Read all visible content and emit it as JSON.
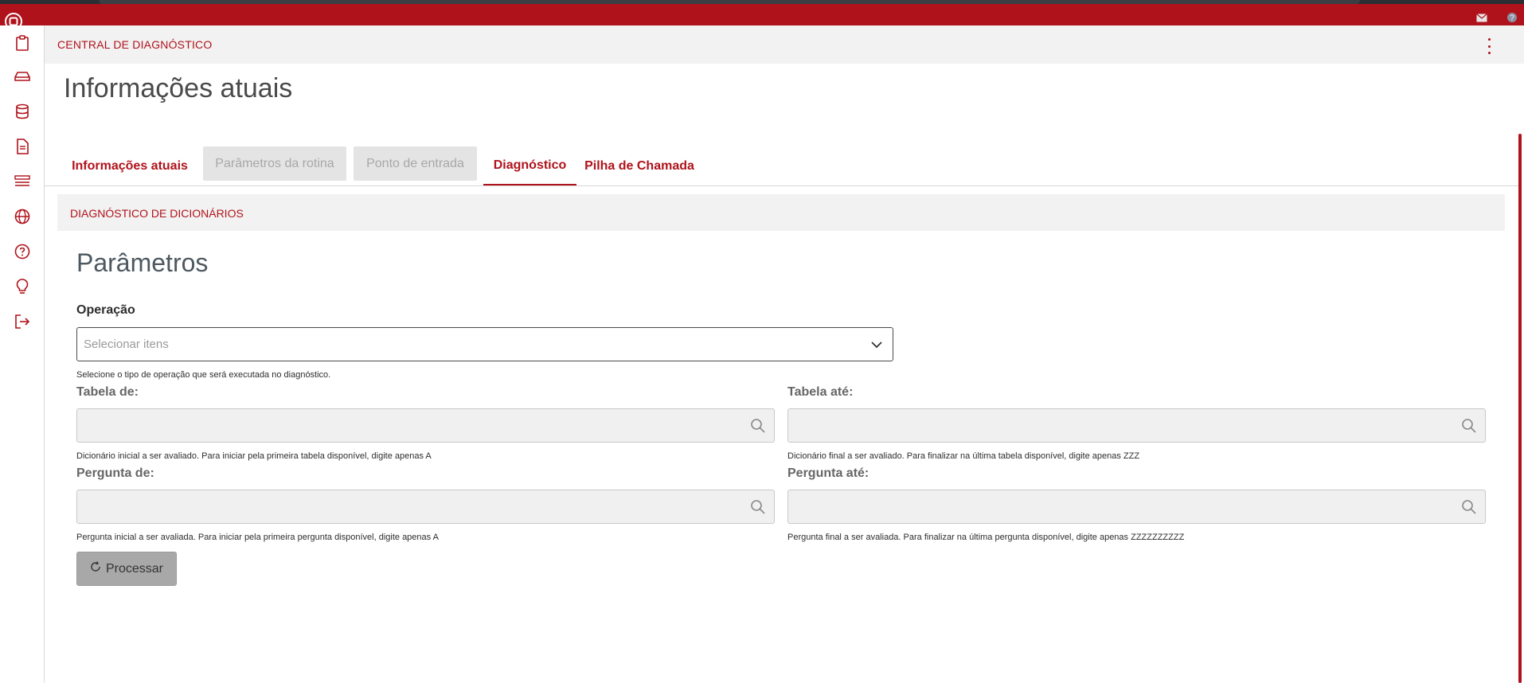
{
  "app": {
    "title": "CENTRAL DE DIAGNÓSTICO",
    "brand_color": "#b0121b"
  },
  "sidebar": {
    "items": [
      {
        "icon": "clipboard-icon"
      },
      {
        "icon": "hard-drive-icon"
      },
      {
        "icon": "database-icon"
      },
      {
        "icon": "document-icon"
      },
      {
        "icon": "list-icon"
      },
      {
        "icon": "globe-icon"
      },
      {
        "icon": "help-circle-icon"
      },
      {
        "icon": "lightbulb-icon"
      },
      {
        "icon": "logout-icon"
      }
    ]
  },
  "page": {
    "title": "Informações atuais"
  },
  "tabs": [
    {
      "label": "Informações atuais",
      "state": "enabled"
    },
    {
      "label": "Parâmetros da rotina",
      "state": "disabled"
    },
    {
      "label": "Ponto de entrada",
      "state": "disabled"
    },
    {
      "label": "Diagnóstico",
      "state": "selected"
    },
    {
      "label": "Pilha de Chamada",
      "state": "enabled"
    }
  ],
  "section": {
    "title": "DIAGNÓSTICO DE DICIONÁRIOS"
  },
  "form": {
    "title": "Parâmetros",
    "operacao": {
      "label": "Operação",
      "placeholder": "Selecionar itens",
      "helper": "Selecione o tipo de operação que será executada no diagnóstico."
    },
    "tabela_de": {
      "label": "Tabela de:",
      "helper": "Dicionário inicial a ser avaliado. Para iniciar pela primeira tabela disponível, digite apenas A"
    },
    "tabela_ate": {
      "label": "Tabela até:",
      "helper": "Dicionário final a ser avaliado. Para finalizar na última tabela disponível, digite apenas ZZZ"
    },
    "pergunta_de": {
      "label": "Pergunta de:",
      "helper": "Pergunta inicial a ser avaliada. Para iniciar pela primeira pergunta disponível, digite apenas A"
    },
    "pergunta_ate": {
      "label": "Pergunta até:",
      "helper": "Pergunta final a ser avaliada. Para finalizar na última pergunta disponível, digite apenas ZZZZZZZZZZ"
    },
    "process_button": "Processar"
  }
}
